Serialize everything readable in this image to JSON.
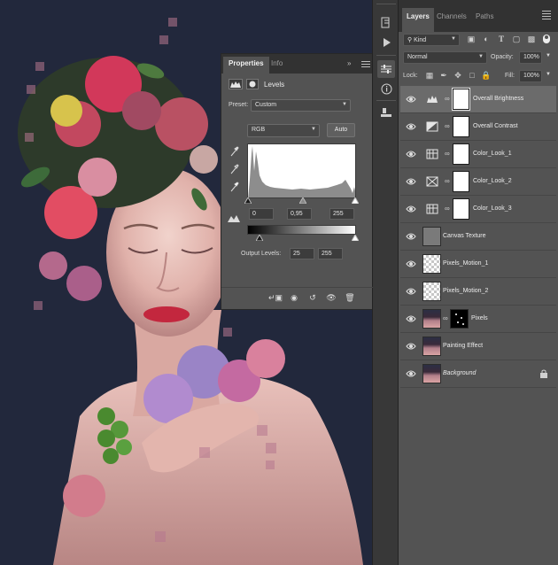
{
  "layers_panel": {
    "tabs": [
      "Layers",
      "Channels",
      "Paths"
    ],
    "filter_kind": "Kind",
    "blend_mode": "Normal",
    "opacity_label": "Opacity:",
    "opacity_value": "100%",
    "lock_label": "Lock:",
    "fill_label": "Fill:",
    "fill_value": "100%",
    "layers": [
      {
        "name": "Overall Brightness",
        "type": "levels",
        "selected": true
      },
      {
        "name": "Overall Contrast",
        "type": "brightness-contrast",
        "selected": false
      },
      {
        "name": "Color_Look_1",
        "type": "color-lookup",
        "selected": false
      },
      {
        "name": "Color_Look_2",
        "type": "gradient-map",
        "selected": false
      },
      {
        "name": "Color_Look_3",
        "type": "color-lookup",
        "selected": false
      },
      {
        "name": "Canvas Texture",
        "type": "fill",
        "selected": false
      },
      {
        "name": "Pixels_Motion_1",
        "type": "transparent",
        "selected": false
      },
      {
        "name": "Pixels_Motion_2",
        "type": "transparent",
        "selected": false
      },
      {
        "name": "Pixels",
        "type": "photo-mask",
        "selected": false
      },
      {
        "name": "Painting Effect",
        "type": "photo",
        "selected": false
      },
      {
        "name": "Background",
        "type": "photo-locked",
        "selected": false
      }
    ]
  },
  "properties_panel": {
    "tabs": [
      "Properties",
      "Info"
    ],
    "adjustment_title": "Levels",
    "preset_label": "Preset:",
    "preset_value": "Custom",
    "channel_value": "RGB",
    "auto_button": "Auto",
    "input_black": "0",
    "input_gamma": "0,95",
    "input_white": "255",
    "output_label": "Output Levels:",
    "output_black": "25",
    "output_white": "255"
  },
  "icons": {
    "eye": "eye-icon",
    "chain": "link-icon",
    "lock": "lock-icon"
  },
  "colors": {
    "panel_bg": "#535353",
    "selected_layer": "#6b6b6b",
    "canvas_bg": "#22283c"
  }
}
